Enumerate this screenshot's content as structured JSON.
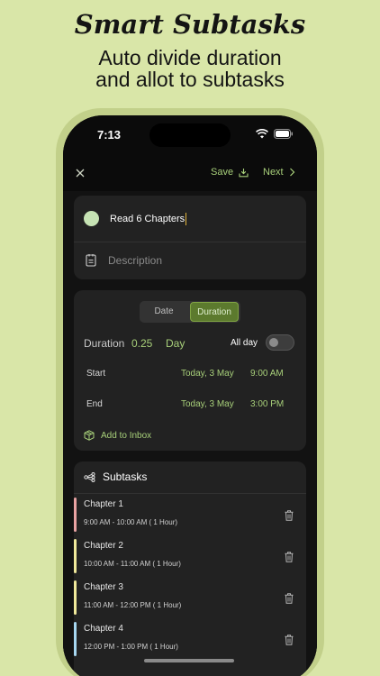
{
  "promo": {
    "title": "Smart Subtasks",
    "subtitle_line1": "Auto divide duration",
    "subtitle_line2": "and allot to subtasks"
  },
  "status_bar": {
    "time": "7:13"
  },
  "navbar": {
    "close_icon": "close-icon",
    "save_label": "Save",
    "next_label": "Next"
  },
  "task": {
    "name": "Read 6 Chapters",
    "color": "#c6e3b4",
    "description_placeholder": "Description"
  },
  "schedule": {
    "mode_tabs": [
      "Date",
      "Duration"
    ],
    "selected_tab": "Duration",
    "duration_label": "Duration",
    "duration_value": "0.25",
    "duration_unit": "Day",
    "all_day_label": "All day",
    "all_day_enabled": false,
    "start": {
      "label": "Start",
      "date": "Today, 3 May",
      "time": "9:00 AM"
    },
    "end": {
      "label": "End",
      "date": "Today, 3 May",
      "time": "3:00 PM"
    },
    "add_to_inbox_label": "Add to Inbox"
  },
  "subtasks": {
    "header": "Subtasks",
    "items": [
      {
        "title": "Chapter 1",
        "time": "9:00 AM - 10:00 AM ( 1 Hour)",
        "color": "#e8a2a2"
      },
      {
        "title": "Chapter 2",
        "time": "10:00 AM - 11:00 AM ( 1 Hour)",
        "color": "#efe89a"
      },
      {
        "title": "Chapter 3",
        "time": "11:00 AM - 12:00 PM ( 1 Hour)",
        "color": "#efe89a"
      },
      {
        "title": "Chapter 4",
        "time": "12:00 PM - 1:00 PM ( 1 Hour)",
        "color": "#a6d6f0"
      }
    ]
  },
  "colors": {
    "accent": "#a8d07a",
    "background": "#d9e6a8",
    "card": "#222222"
  }
}
